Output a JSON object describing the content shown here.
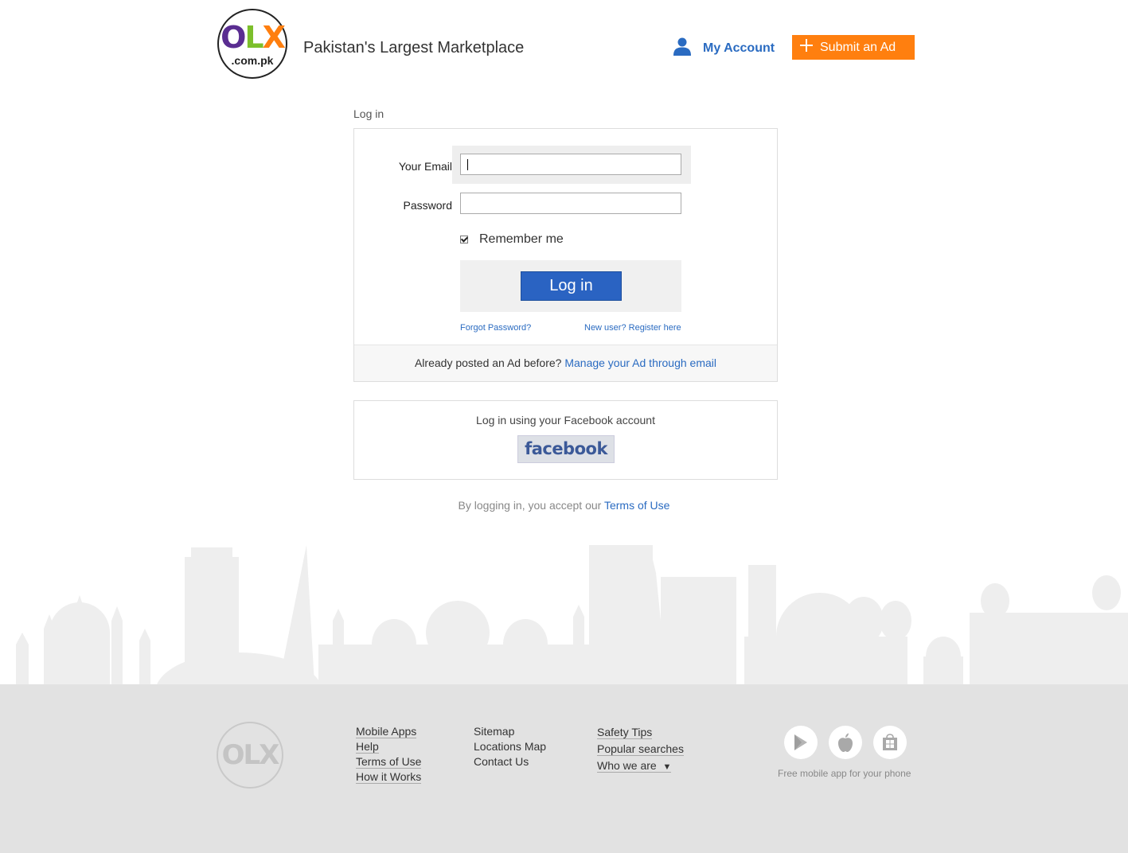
{
  "header": {
    "logo_text": "OLX",
    "logo_domain": ".com.pk",
    "tagline": "Pakistan's Largest Marketplace",
    "account_label": "My Account",
    "submit_label": "Submit an Ad"
  },
  "login": {
    "section_title": "Log in",
    "email_label": "Your Email",
    "email_value": "",
    "password_label": "Password",
    "password_value": "",
    "remember_label": "Remember me",
    "remember_checked": true,
    "login_button": "Log in",
    "forgot_link": "Forgot Password?",
    "register_link": "New user? Register here",
    "posted_text": "Already posted an Ad before?",
    "manage_link": "Manage your Ad through email"
  },
  "facebook": {
    "prompt": "Log in using your Facebook account",
    "button_text": "facebook"
  },
  "terms": {
    "text": "By logging in, you accept our",
    "link": "Terms of Use"
  },
  "footer": {
    "logo_text": "OLX",
    "col1": [
      "Mobile Apps",
      "Help",
      "Terms of Use",
      "How it Works"
    ],
    "col2": [
      "Sitemap",
      "Locations Map",
      "Contact Us"
    ],
    "col3": [
      "Safety Tips",
      "Popular searches",
      "Who we are"
    ],
    "app_caption": "Free mobile app for your phone",
    "app_icons": [
      "google-play-icon",
      "apple-icon",
      "windows-store-icon"
    ]
  },
  "colors": {
    "accent_orange": "#ff7f0f",
    "link_blue": "#2a6bc1",
    "button_blue": "#2a63c2",
    "facebook_blue": "#3b5998",
    "footer_gray": "#e2e2e2"
  }
}
